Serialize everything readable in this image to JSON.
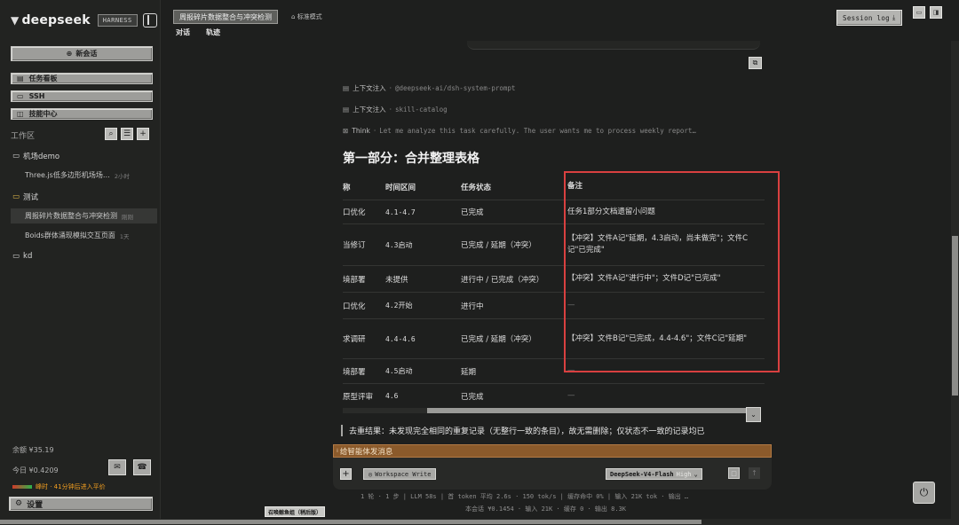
{
  "app": {
    "brand": "deepseek",
    "badge": "HARNESS"
  },
  "sidebar": {
    "new_chat": "新会话",
    "menu": [
      {
        "icon": "board-icon",
        "label": "任务看板"
      },
      {
        "icon": "terminal-icon",
        "label": "SSH"
      },
      {
        "icon": "skill-icon",
        "label": "技能中心"
      }
    ],
    "workspace_label": "工作区",
    "tree": [
      {
        "type": "folder",
        "label": "机场demo"
      },
      {
        "type": "item",
        "label": "Three.js低多边形机场场…",
        "time": "2小时"
      },
      {
        "type": "folder",
        "label": "测试"
      },
      {
        "type": "item",
        "label": "周报碎片数据整合与冲突检测",
        "time": "刚刚",
        "active": true
      },
      {
        "type": "item",
        "label": "Boids群体涌现模拟交互页面",
        "time": "1天"
      },
      {
        "type": "folder",
        "label": "kd"
      }
    ],
    "balance": "余额 ¥35.19",
    "today": "今日 ¥0.4209",
    "promo": "峰时 · 41分钟后进入平价",
    "settings": "设置"
  },
  "topbar": {
    "title": "周报碎片数据整合与冲突检测",
    "mode": "标准模式",
    "tabs": [
      "对话",
      "轨迹"
    ],
    "session_log": "Session log"
  },
  "chat": {
    "context": [
      {
        "label": "上下文注入",
        "value": "@deepseek-ai/dsh-system-prompt"
      },
      {
        "label": "上下文注入",
        "value": "skill-catalog"
      },
      {
        "label": "Think",
        "value": "Let me analyze this task carefully. The user wants me to process weekly report…"
      }
    ],
    "section_title": "第一部分：合并整理表格",
    "table": {
      "headers": [
        "称",
        "时间区间",
        "任务状态",
        "备注"
      ],
      "rows": [
        [
          "口优化",
          "4.1-4.7",
          "已完成",
          "任务1部分文档遗留小问题"
        ],
        [
          "当修订",
          "4.3启动",
          "已完成 / 延期（冲突）",
          "【冲突】文件A记\"延期，4.3启动，尚未做完\"；文件C记\"已完成\""
        ],
        [
          "境部署",
          "未提供",
          "进行中 / 已完成（冲突）",
          "【冲突】文件A记\"进行中\"；文件D记\"已完成\""
        ],
        [
          "口优化",
          "4.2开始",
          "进行中",
          "—"
        ],
        [
          "求调研",
          "4.4-4.6",
          "已完成 / 延期（冲突）",
          "【冲突】文件B记\"已完成，4.4-4.6\"；文件C记\"延期\""
        ],
        [
          "境部署",
          "4.5启动",
          "延期",
          "—"
        ],
        [
          "原型评审",
          "4.6",
          "已完成",
          "—"
        ]
      ]
    },
    "dedupe_text": "去重结果：未发现完全相同的重复记录（无整行一致的条目），故无需删除；仅状态不一致的记录均已",
    "inject_label": "给智能体发消息",
    "workspace_write": "Workspace Write",
    "model": "DeepSeek-V4-Flash",
    "model_tier": "High",
    "stats_line1": "1 轮 · 1 步 | LLM 58s | 首 token 平均 2.6s · 150 tok/s | 缓存命中 0% | 输入 21K tok · 输出 …",
    "stats_line2": "本会话 ¥0.1454 · 输入 21K · 缓存 0 · 输出 8.3K",
    "bottom_tag": "召唤鲸鱼姐（稍后版）"
  },
  "colors": {
    "highlight_box": "#d94040",
    "inject_bar": "#8b5a2b",
    "promo": "#f5a020"
  }
}
